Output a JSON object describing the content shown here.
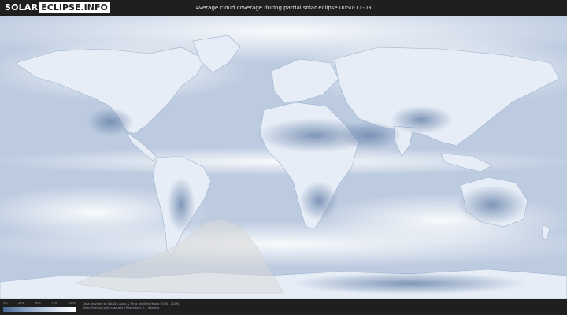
{
  "header": {
    "logo_part1": "SOLAR",
    "logo_part2": "ECLIPSE.INFO",
    "title": "Average cloud coverage during partial solar eclipse 0050-11-03"
  },
  "legend": {
    "ticks": [
      "0%",
      "25%",
      "50%",
      "75%",
      "100%"
    ],
    "colors": [
      "#4a6a96",
      "#7d97bb",
      "#aebfd6",
      "#dbe5f1",
      "#ffffff"
    ]
  },
  "credits": {
    "line1": "Data provided by NASA's Aqua & Terra satellite (Years: 2000 - 2019)",
    "line2": "https://neo.sci.gsfc.nasa.gov | Resolution: 0.1 degrees"
  },
  "map": {
    "background_color": "#b9c9de",
    "land_color": "#e8eef6",
    "eclipse_zone_color": "#d9d9d9",
    "eclipse_zone": "partial eclipse visibility area (southern hemisphere, South America / Antarctica)"
  }
}
